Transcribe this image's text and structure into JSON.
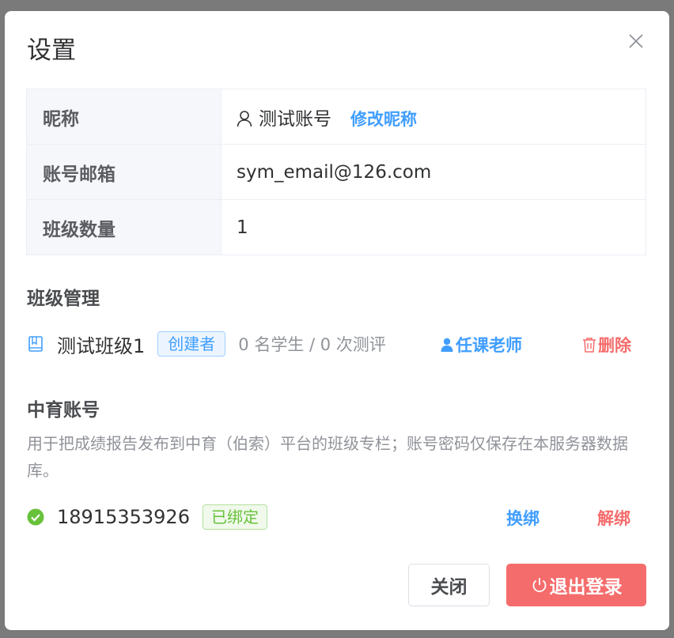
{
  "dialog": {
    "title": "设置",
    "close_icon": "close-icon"
  },
  "profile": {
    "nickname_label": "昵称",
    "nickname_value": "测试账号",
    "edit_nickname_label": "修改昵称",
    "email_label": "账号邮箱",
    "email_value": "sym_email@126.com",
    "class_count_label": "班级数量",
    "class_count_value": "1"
  },
  "class_management": {
    "title": "班级管理",
    "classes": [
      {
        "name": "测试班级1",
        "role_tag": "创建者",
        "stats": "0 名学生 / 0 次测评",
        "teacher_action": "任课老师",
        "delete_action": "删除"
      }
    ]
  },
  "zhongyu": {
    "title": "中育账号",
    "description": "用于把成绩报告发布到中育（伯索）平台的班级专栏；账号密码仅保存在本服务器数据库。",
    "account": "18915353926",
    "status_tag": "已绑定",
    "rebind_label": "换绑",
    "unbind_label": "解绑"
  },
  "footer": {
    "close_label": "关闭",
    "logout_label": "退出登录"
  },
  "colors": {
    "primary": "#409eff",
    "danger": "#f56c6c",
    "success": "#67c23a"
  }
}
